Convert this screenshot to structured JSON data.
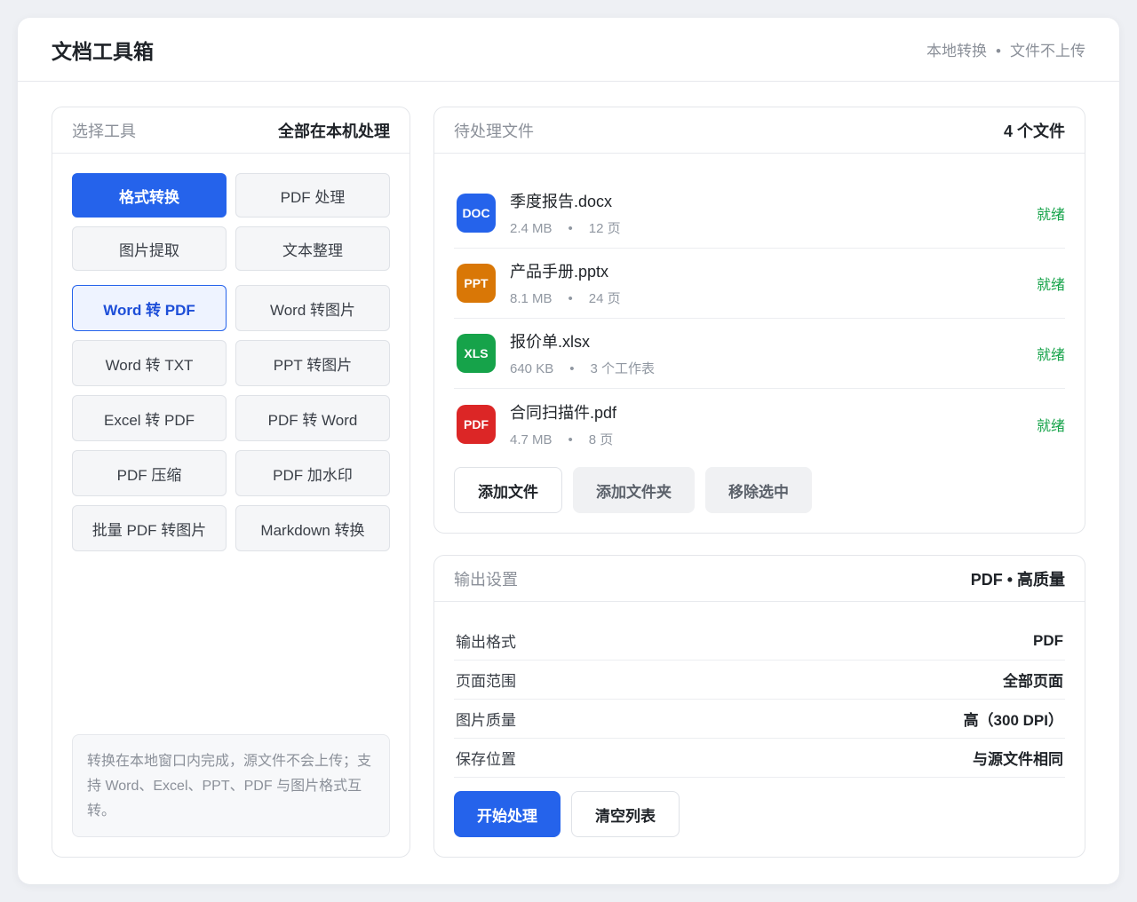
{
  "header": {
    "title": "文档工具箱",
    "note_left": "本地转换",
    "note_sep": "•",
    "note_right": "文件不上传"
  },
  "tools_panel": {
    "label": "选择工具",
    "value": "全部在本机处理",
    "tabs": [
      "格式转换",
      "PDF 处理",
      "图片提取",
      "文本整理"
    ],
    "active_tab": "格式转换",
    "tools": [
      "Word 转 PDF",
      "Word 转图片",
      "Word 转 TXT",
      "PPT 转图片",
      "Excel 转 PDF",
      "PDF 转 Word",
      "PDF 压缩",
      "PDF 加水印",
      "批量 PDF 转图片",
      "Markdown 转换"
    ],
    "active_tool": "Word 转 PDF",
    "hint": "转换在本地窗口内完成，源文件不会上传；支持 Word、Excel、PPT、PDF 与图片格式互转。"
  },
  "files_panel": {
    "label": "待处理文件",
    "count": "4 个文件",
    "files": [
      {
        "badge": "DOC",
        "color": "#2563eb",
        "name": "季度报告.docx",
        "size": "2.4 MB",
        "sep": "•",
        "extra": "12 页",
        "status": "就绪"
      },
      {
        "badge": "PPT",
        "color": "#d97706",
        "name": "产品手册.pptx",
        "size": "8.1 MB",
        "sep": "•",
        "extra": "24 页",
        "status": "就绪"
      },
      {
        "badge": "XLS",
        "color": "#16a34a",
        "name": "报价单.xlsx",
        "size": "640 KB",
        "sep": "•",
        "extra": "3 个工作表",
        "status": "就绪"
      },
      {
        "badge": "PDF",
        "color": "#dc2626",
        "name": "合同扫描件.pdf",
        "size": "4.7 MB",
        "sep": "•",
        "extra": "8 页",
        "status": "就绪"
      }
    ],
    "actions": {
      "add_file": "添加文件",
      "add_folder": "添加文件夹",
      "remove_selected": "移除选中"
    }
  },
  "output_panel": {
    "label": "输出设置",
    "summary": "PDF • 高质量",
    "settings": [
      {
        "key": "输出格式",
        "value": "PDF"
      },
      {
        "key": "页面范围",
        "value": "全部页面"
      },
      {
        "key": "图片质量",
        "value": "高（300 DPI）"
      },
      {
        "key": "保存位置",
        "value": "与源文件相同"
      }
    ],
    "actions": {
      "start": "开始处理",
      "clear": "清空列表"
    }
  }
}
